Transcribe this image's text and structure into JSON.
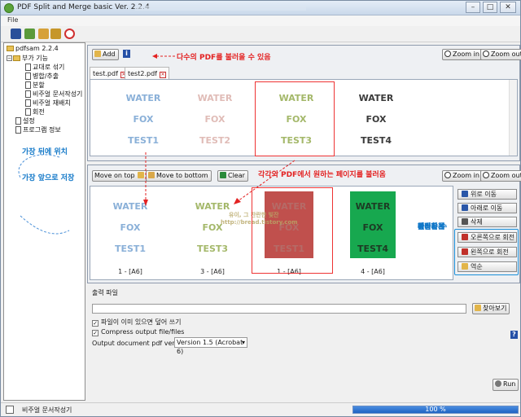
{
  "window": {
    "title": "PDF Split and Merge basic Ver. 2.2.4",
    "buttons": [
      "–",
      "□",
      "✕"
    ]
  },
  "menu": {
    "file": "File"
  },
  "sidebar": {
    "root": "pdfsam 2.2.4",
    "group": "부가 기능",
    "items": [
      "교대로 섞기",
      "병합/추출",
      "분할",
      "비주얼 문서작성기",
      "비주얼 재배치",
      "회전"
    ],
    "settings": "설정",
    "program_info": "프로그램 정보"
  },
  "top_panel": {
    "add_label": "Add",
    "info_icon": "i",
    "zoom_in": "Zoom in",
    "zoom_out": "Zoom out",
    "tabs": [
      "test.pdf",
      "test2.pdf"
    ],
    "pages": [
      {
        "lines": [
          "WATER",
          "FOX",
          "TEST1"
        ],
        "color": "#8ab0d8"
      },
      {
        "lines": [
          "WATER",
          "FOX",
          "TEST2"
        ],
        "color": "#e0bcb7"
      },
      {
        "lines": [
          "WATER",
          "FOX",
          "TEST3"
        ],
        "color": "#a4b86a"
      },
      {
        "lines": [
          "WATER",
          "FOX",
          "TEST4"
        ],
        "color": "#3b3b3b"
      }
    ]
  },
  "bottom_panel": {
    "move_top": "Move on top",
    "move_bottom": "Move to bottom",
    "clear": "Clear",
    "zoom_in": "Zoom in",
    "zoom_out": "Zoom out",
    "pages": [
      {
        "lines": [
          "WATER",
          "FOX",
          "TEST1"
        ],
        "label": "1 - [A6]",
        "style": "plain",
        "color": "#8ab0d8"
      },
      {
        "lines": [
          "WATER",
          "FOX",
          "TEST3"
        ],
        "label": "3 - [A6]",
        "style": "plain",
        "color": "#a4b86a"
      },
      {
        "lines": [
          "WATER",
          "FOX",
          "TEST1"
        ],
        "label": "1 - [A6]",
        "style": "red",
        "color": "#b56b67"
      },
      {
        "lines": [
          "WATER",
          "FOX",
          "TEST4"
        ],
        "label": "4 - [A6]",
        "style": "green",
        "color": "#1d3b24"
      }
    ],
    "actions": [
      "위로 이동",
      "아래로 이동",
      "삭제",
      "오른쪽으로 회전",
      "왼쪽으로 회전",
      "역순"
    ]
  },
  "annotations": {
    "top": "다수의 PDF를 불러올 수 있음",
    "middle": "각각의 PDF에서 원하는 페이지를 불러옴",
    "back": "가장 뒤에 위치",
    "front": "가장 앞으로 저장",
    "edit": [
      "돌려은",
      "페이지를",
      "간단하게",
      "편집할 수",
      "있음"
    ],
    "watermark": [
      "유이, 그 찬란한 빛잔",
      "http://bread.tistory.com"
    ]
  },
  "output": {
    "label": "출력 파일",
    "browse": "찾아보기",
    "overwrite": "파일이 이미 있으면 덮어 쓰기",
    "compress": "Compress output file/files",
    "version_label": "Output document pdf version:",
    "version_value": "Version 1.5 (Acrobat 6)",
    "help": "?",
    "run": "Run"
  },
  "status": {
    "text": "비주얼 문서작성기",
    "progress": 100,
    "progress_text": "100 %"
  },
  "colors": {
    "accent_red": "#e32222",
    "accent_blue": "#1278c8",
    "selection": "#3a7bd5"
  }
}
